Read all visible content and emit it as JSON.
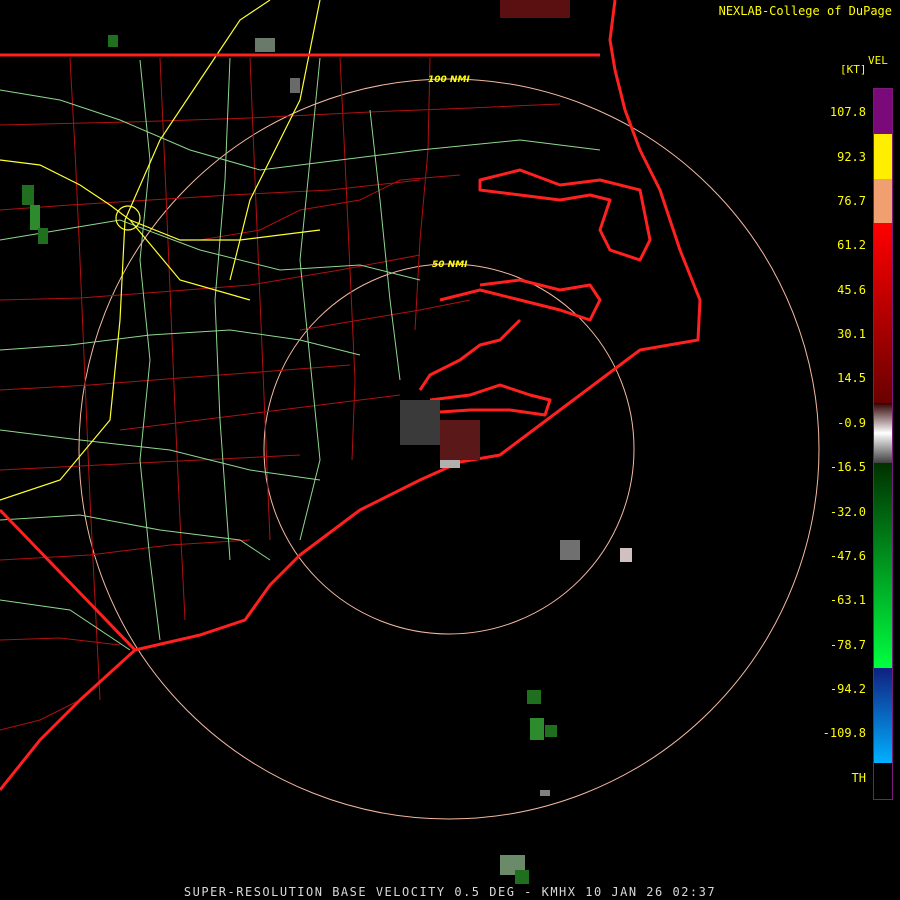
{
  "credit": "NEXLAB-College of DuPage",
  "legend": {
    "product": "VEL",
    "units": "[KT]",
    "ticks": [
      "107.8",
      "92.3",
      "76.7",
      "61.2",
      "45.6",
      "30.1",
      "14.5",
      "-0.9",
      "-16.5",
      "-32.0",
      "-47.6",
      "-63.1",
      "-78.7",
      "-94.2",
      "-109.8",
      "TH"
    ]
  },
  "range_rings": {
    "inner": "50 NMI",
    "outer": "100 NMI"
  },
  "footer": "SUPER-RESOLUTION BASE VELOCITY 0.5 DEG - KMHX 10 JAN 26 02:37",
  "colors": {
    "text": "#ffff00",
    "state_border": "#ff2020",
    "county": "#b01010",
    "highway": "#8fd88f",
    "interstate": "#ffff30",
    "ring": "#f4b9a0"
  }
}
